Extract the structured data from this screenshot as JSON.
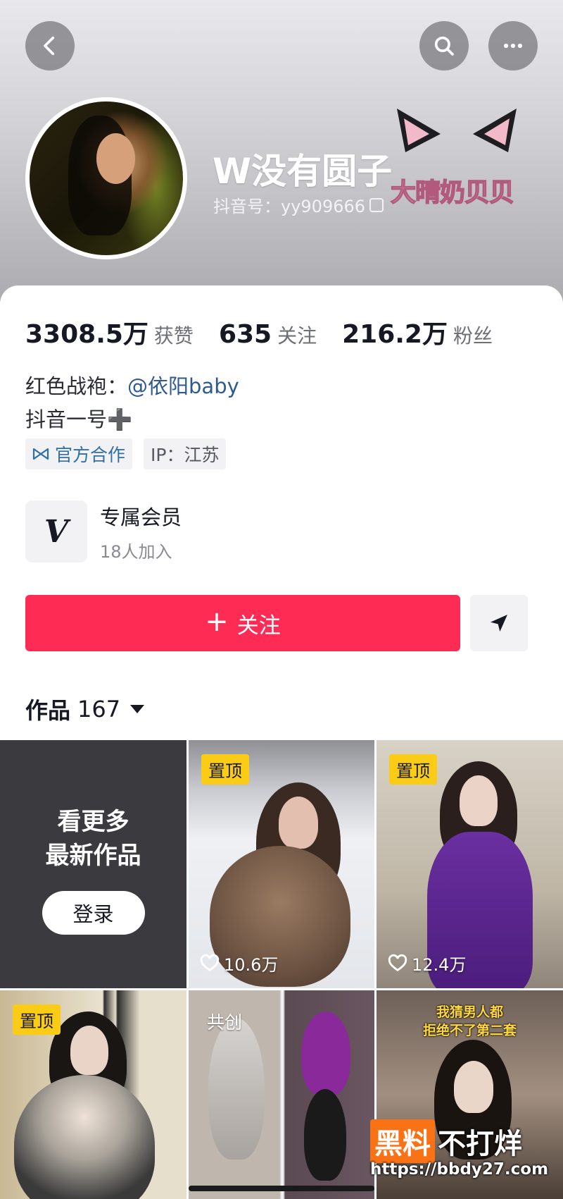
{
  "profile": {
    "nickname": "W没有圆子",
    "douyin_id": "抖音号：yy909666",
    "top_watermark": "大晴奶贝贝"
  },
  "stats": [
    {
      "value": "3308.5万",
      "label": "获赞"
    },
    {
      "value": "635",
      "label": "关注"
    },
    {
      "value": "216.2万",
      "label": "粉丝"
    }
  ],
  "bio": {
    "line1_prefix": "红色战袍：",
    "line1_mention": "@依阳baby",
    "line2": "抖音一号➕"
  },
  "tags": {
    "official": "官方合作",
    "ip": "IP：江苏"
  },
  "member": {
    "logo": "V",
    "title": "专属会员",
    "subtitle": "18人加入"
  },
  "actions": {
    "follow_label": "关注",
    "follow_plus": "+"
  },
  "works": {
    "label": "作品",
    "count": "167"
  },
  "grid": {
    "login_line1": "看更多",
    "login_line2": "最新作品",
    "login_button": "登录",
    "items": [
      {
        "badge": "置顶",
        "likes": "10.6万"
      },
      {
        "badge": "置顶",
        "likes": "12.4万"
      },
      {
        "badge": "置顶"
      },
      {
        "badge": "共创"
      },
      {
        "caption_line1": "我猜男人都",
        "caption_line2": "拒绝不了第二套"
      }
    ]
  },
  "footer_watermark": {
    "brand_highlight": "黑料",
    "brand_rest": "不打烊",
    "url": "https://bbdy27.com"
  },
  "colors": {
    "accent": "#fe2c55",
    "link": "#2f5a8f",
    "badge": "#facc15"
  }
}
